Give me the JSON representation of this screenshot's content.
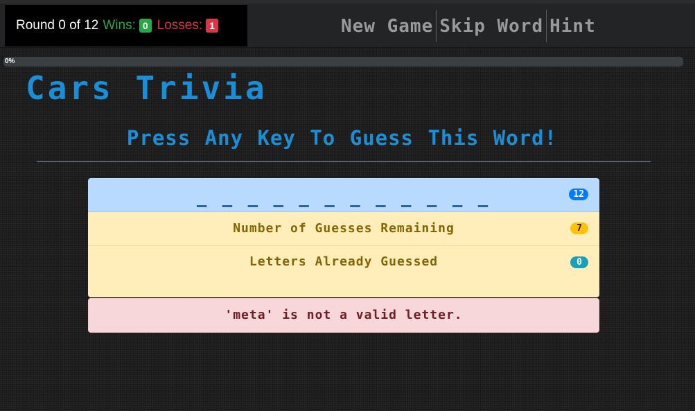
{
  "scoreboard": {
    "round_text": "Round 0 of 12",
    "wins_label": "Wins:",
    "wins_count": "0",
    "losses_label": "Losses:",
    "losses_count": "1"
  },
  "nav": {
    "new_game": "New Game",
    "skip_word": "Skip Word",
    "hint": "Hint"
  },
  "progress": {
    "label": "0%",
    "value": 0
  },
  "game": {
    "title": "Cars Trivia",
    "prompt": "Press Any Key To Guess This Word!",
    "word_blanks": "_ _ _ _ _ _ _ _ _ _ _ _",
    "word_length": "12",
    "guesses_label": "Number of Guesses Remaining",
    "guesses_remaining": "7",
    "letters_label": "Letters Already Guessed",
    "letters_count": "0",
    "error_message": "'meta' is not a valid letter."
  },
  "colors": {
    "accent_blue": "#1a8fd8",
    "wins_green": "#28a745",
    "losses_red": "#dc3545"
  }
}
